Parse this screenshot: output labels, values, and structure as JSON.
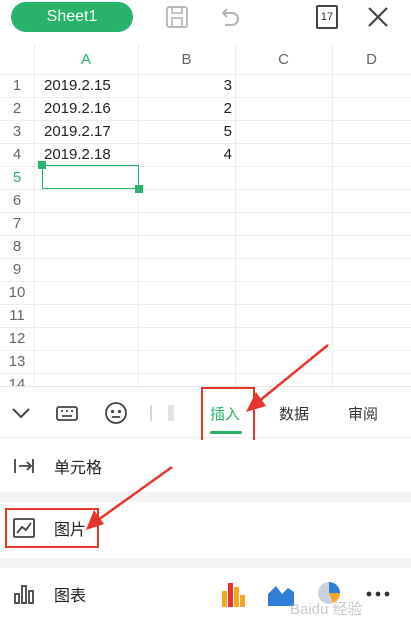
{
  "topbar": {
    "sheet_tab": "Sheet1",
    "sheet_count": "17"
  },
  "grid": {
    "columns": [
      "A",
      "B",
      "C",
      "D"
    ],
    "rows": [
      "1",
      "2",
      "3",
      "4",
      "5",
      "6",
      "7",
      "8",
      "9",
      "10",
      "11",
      "12",
      "13",
      "14"
    ],
    "data": [
      {
        "a": "2019.2.15",
        "b": "3"
      },
      {
        "a": "2019.2.16",
        "b": "2"
      },
      {
        "a": "2019.2.17",
        "b": "5"
      },
      {
        "a": "2019.2.18",
        "b": "4"
      }
    ],
    "selected_row": "5",
    "accent": "#27b36a"
  },
  "toolbar": {
    "tabs": [
      "插入",
      "数据",
      "审阅"
    ],
    "active_tab": "插入"
  },
  "menu": {
    "items": [
      "单元格",
      "图片",
      "图表"
    ]
  },
  "watermark": "Baidu 经验"
}
